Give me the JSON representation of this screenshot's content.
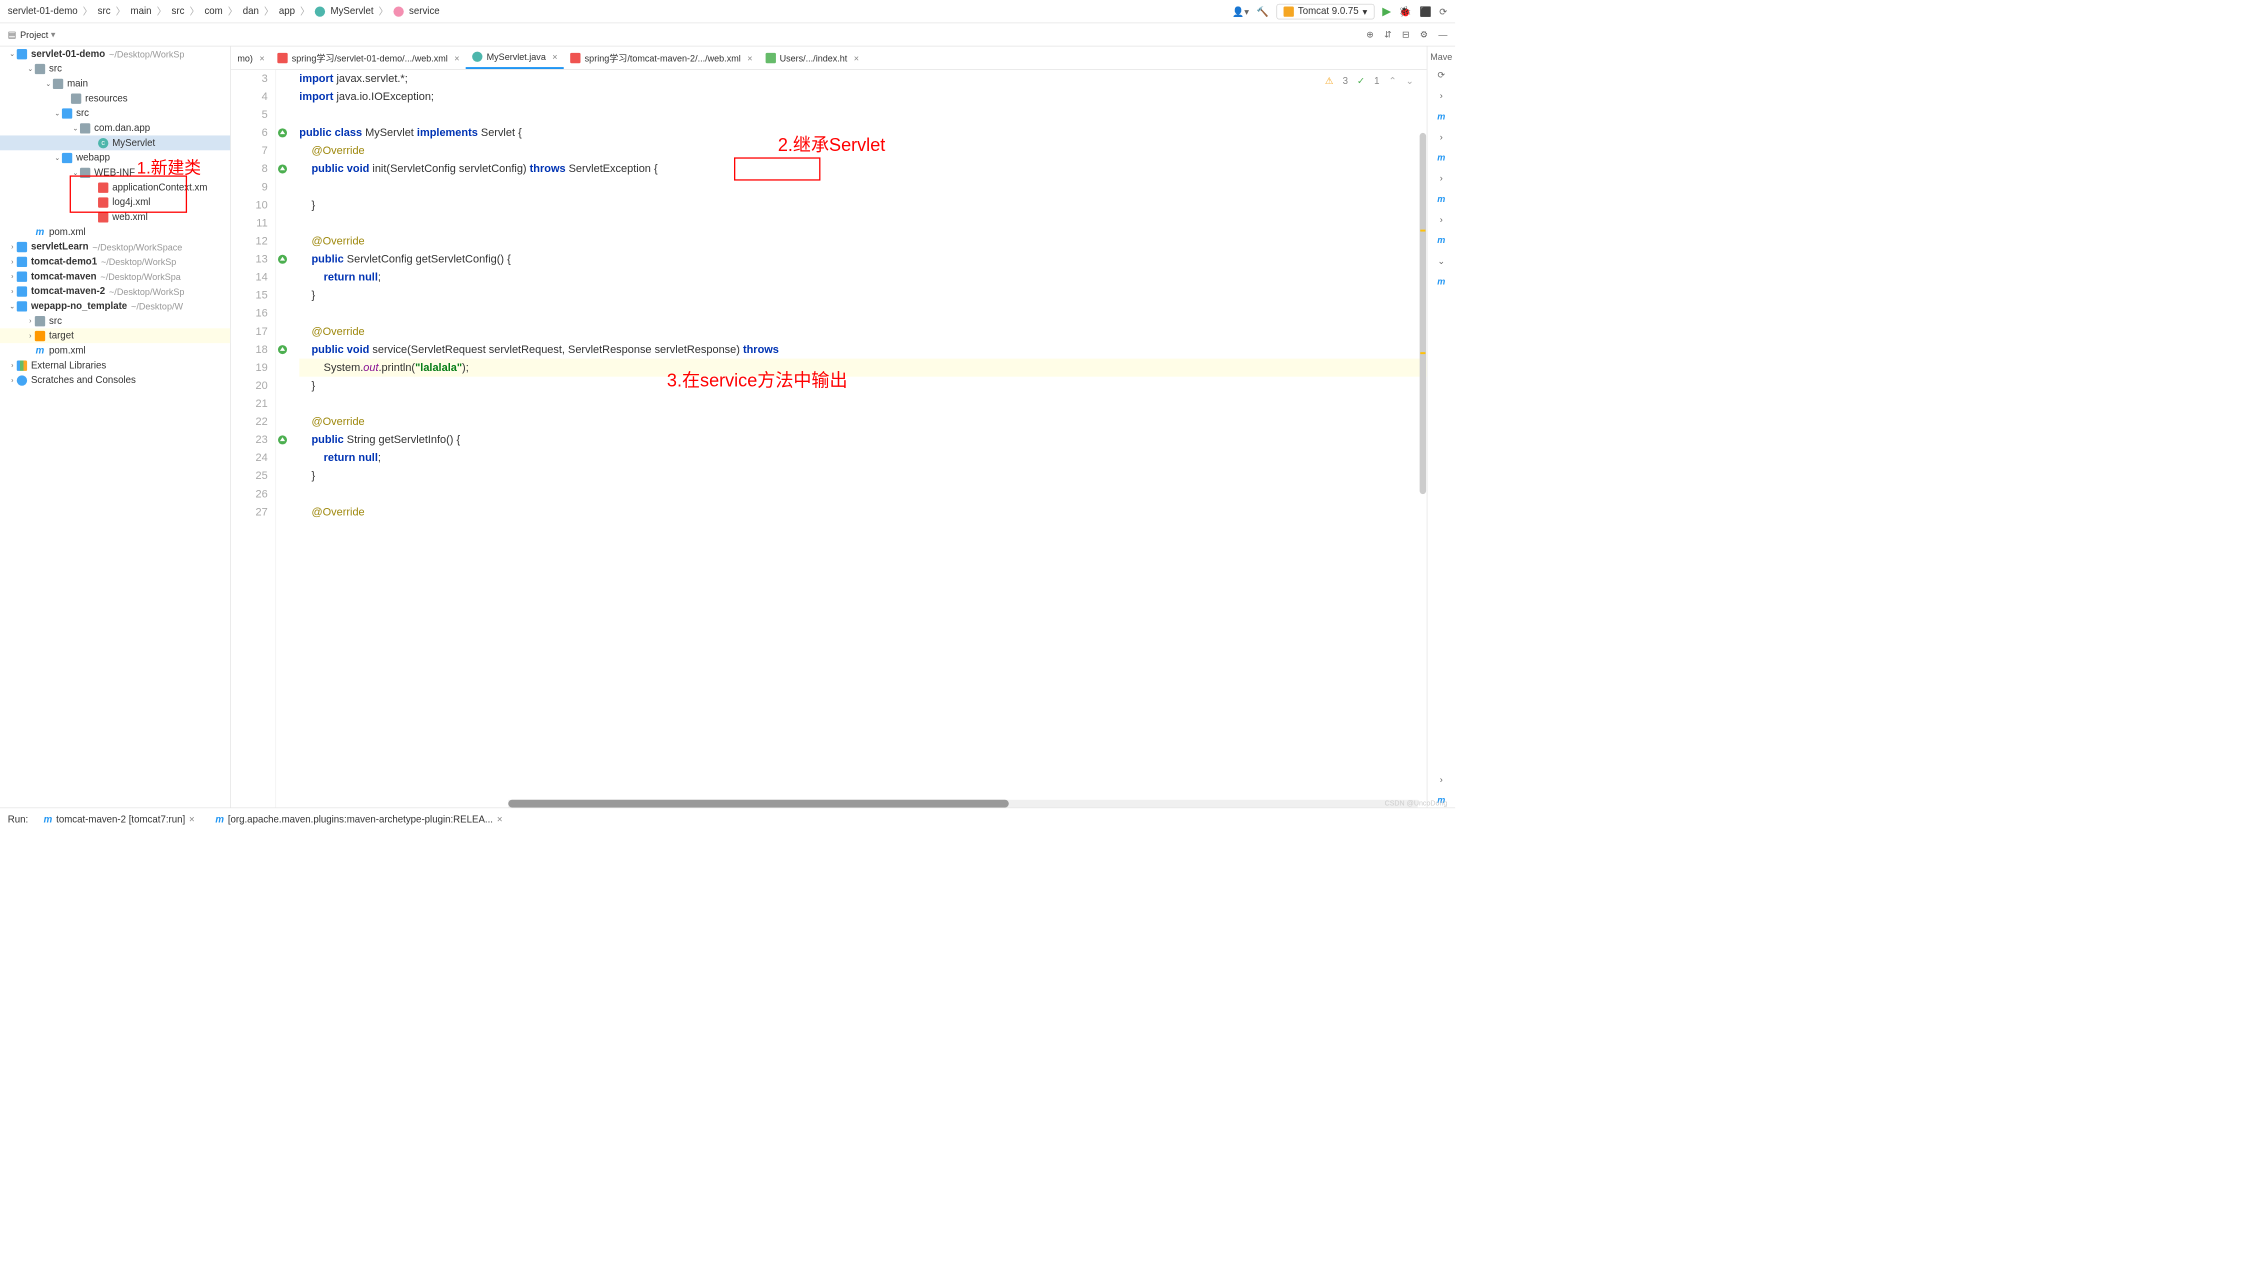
{
  "breadcrumb": {
    "items": [
      "servlet-01-demo",
      "src",
      "main",
      "src",
      "com",
      "dan",
      "app",
      "MyServlet",
      "service"
    ]
  },
  "toolbar": {
    "run_config": "Tomcat 9.0.75",
    "dropdown_arrow": "▾"
  },
  "project_bar": {
    "label": "Project",
    "arrow": "▾"
  },
  "tree": {
    "root": {
      "name": "servlet-01-demo",
      "path": "~/Desktop/WorkSp"
    },
    "src": "src",
    "main": "main",
    "resources": "resources",
    "src2": "src",
    "package": "com.dan.app",
    "myservlet": "MyServlet",
    "webapp": "webapp",
    "webinf": "WEB-INF",
    "appctx": "applicationContext.xm",
    "log4j": "log4j.xml",
    "webxml": "web.xml",
    "pom1": "pom.xml",
    "servletlearn": {
      "name": "servletLearn",
      "path": "~/Desktop/WorkSpace"
    },
    "tomcatdemo1": {
      "name": "tomcat-demo1",
      "path": "~/Desktop/WorkSp"
    },
    "tomcatmaven": {
      "name": "tomcat-maven",
      "path": "~/Desktop/WorkSpa"
    },
    "tomcatmaven2": {
      "name": "tomcat-maven-2",
      "path": "~/Desktop/WorkSp"
    },
    "wepapp": {
      "name": "wepapp-no_template",
      "path": "~/Desktop/W"
    },
    "src3": "src",
    "target": "target",
    "pom2": "pom.xml",
    "extlib": "External Libraries",
    "scratches": "Scratches and Consoles"
  },
  "annotations": {
    "a1": "1.新建类",
    "a2": "2.继承Servlet",
    "a3": "3.在service方法中输出"
  },
  "tabs": [
    {
      "label": "mo)",
      "type": "java"
    },
    {
      "label": "spring学习/servlet-01-demo/.../web.xml",
      "type": "xml"
    },
    {
      "label": "MyServlet.java",
      "type": "java",
      "active": true
    },
    {
      "label": "spring学习/tomcat-maven-2/.../web.xml",
      "type": "xml"
    },
    {
      "label": "Users/.../index.ht",
      "type": "html"
    }
  ],
  "code": {
    "lines": [
      {
        "n": 3,
        "html": "<span class='kw-blue'>import</span> javax.servlet.*;"
      },
      {
        "n": 4,
        "html": "<span class='kw-blue'>import</span> java.io.IOException;"
      },
      {
        "n": 5,
        "html": ""
      },
      {
        "n": 6,
        "html": "<span class='kw-blue'>public class</span> MyServlet <span class='kw-blue'>implements</span> Servlet {",
        "marker": "impl"
      },
      {
        "n": 7,
        "html": "    <span class='annotation'>@Override</span>"
      },
      {
        "n": 8,
        "html": "    <span class='kw-blue'>public void</span> init(ServletConfig servletConfig) <span class='kw-blue'>throws</span> ServletException {",
        "marker": "impl"
      },
      {
        "n": 9,
        "html": ""
      },
      {
        "n": 10,
        "html": "    }"
      },
      {
        "n": 11,
        "html": ""
      },
      {
        "n": 12,
        "html": "    <span class='annotation'>@Override</span>"
      },
      {
        "n": 13,
        "html": "    <span class='kw-blue'>public</span> ServletConfig getServletConfig() {",
        "marker": "impl"
      },
      {
        "n": 14,
        "html": "        <span class='kw-blue'>return null</span>;"
      },
      {
        "n": 15,
        "html": "    }"
      },
      {
        "n": 16,
        "html": ""
      },
      {
        "n": 17,
        "html": "    <span class='annotation'>@Override</span>"
      },
      {
        "n": 18,
        "html": "    <span class='kw-blue'>public void</span> service(ServletRequest servletRequest, ServletResponse servletResponse) <span class='kw-blue'>throws</span>",
        "marker": "impl"
      },
      {
        "n": 19,
        "html": "        System.<span class='field-static'>out</span>.println(<span class='str'>\"lalalala\"</span>);",
        "current": true
      },
      {
        "n": 20,
        "html": "    }"
      },
      {
        "n": 21,
        "html": ""
      },
      {
        "n": 22,
        "html": "    <span class='annotation'>@Override</span>"
      },
      {
        "n": 23,
        "html": "    <span class='kw-blue'>public</span> String getServletInfo() {",
        "marker": "impl"
      },
      {
        "n": 24,
        "html": "        <span class='kw-blue'>return null</span>;"
      },
      {
        "n": 25,
        "html": "    }"
      },
      {
        "n": 26,
        "html": ""
      },
      {
        "n": 27,
        "html": "    <span class='annotation'>@Override</span>"
      }
    ]
  },
  "status": {
    "warnings": "3",
    "checks": "1"
  },
  "right_panel": {
    "maven": "Mave"
  },
  "bottom": {
    "run_label": "Run:",
    "tab1": "tomcat-maven-2 [tomcat7:run]",
    "tab2": "[org.apache.maven.plugins:maven-archetype-plugin:RELEA..."
  },
  "watermark": "CSDN @UncoDong"
}
